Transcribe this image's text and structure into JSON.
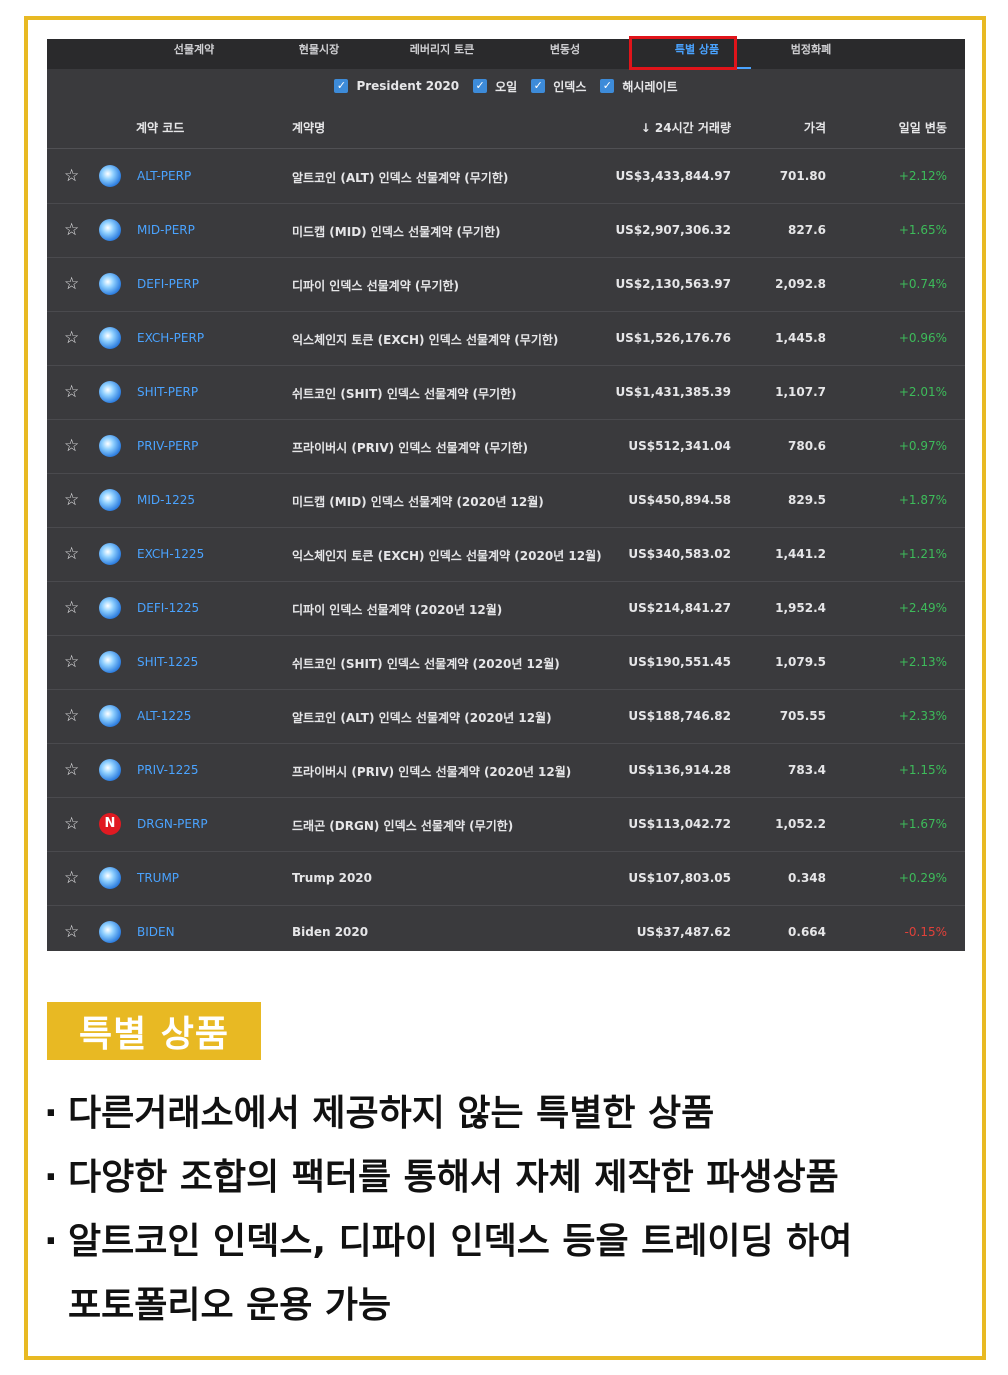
{
  "tabs": [
    {
      "label": "선물계약",
      "active": false
    },
    {
      "label": "현물시장",
      "active": false
    },
    {
      "label": "레버리지 토큰",
      "active": false
    },
    {
      "label": "변동성",
      "active": false
    },
    {
      "label": "특별 상품",
      "active": true
    },
    {
      "label": "범정화폐",
      "active": false
    }
  ],
  "filters": [
    {
      "label": "President 2020",
      "checked": true
    },
    {
      "label": "오일",
      "checked": true
    },
    {
      "label": "인덱스",
      "checked": true
    },
    {
      "label": "해시레이트",
      "checked": true
    }
  ],
  "columns": {
    "code": "계약 코드",
    "name": "계약명",
    "volume": "↓ 24시간 거래량",
    "price": "가격",
    "change": "일일 변동"
  },
  "rows": [
    {
      "code": "ALT-PERP",
      "name": "알트코인 (ALT) 인덱스 선물계약 (무기한)",
      "volume": "US$3,433,844.97",
      "price": "701.80",
      "change": "+2.12%",
      "icon": "globe-icon"
    },
    {
      "code": "MID-PERP",
      "name": "미드캡 (MID) 인덱스 선물계약 (무기한)",
      "volume": "US$2,907,306.32",
      "price": "827.6",
      "change": "+1.65%",
      "icon": "globe-icon"
    },
    {
      "code": "DEFI-PERP",
      "name": "디파이 인덱스 선물계약 (무기한)",
      "volume": "US$2,130,563.97",
      "price": "2,092.8",
      "change": "+0.74%",
      "icon": "globe-icon"
    },
    {
      "code": "EXCH-PERP",
      "name": "익스체인지 토큰 (EXCH) 인덱스 선물계약 (무기한)",
      "volume": "US$1,526,176.76",
      "price": "1,445.8",
      "change": "+0.96%",
      "icon": "globe-icon"
    },
    {
      "code": "SHIT-PERP",
      "name": "쉬트코인 (SHIT) 인덱스 선물계약 (무기한)",
      "volume": "US$1,431,385.39",
      "price": "1,107.7",
      "change": "+2.01%",
      "icon": "globe-icon"
    },
    {
      "code": "PRIV-PERP",
      "name": "프라이버시 (PRIV) 인덱스 선물계약 (무기한)",
      "volume": "US$512,341.04",
      "price": "780.6",
      "change": "+0.97%",
      "icon": "globe-icon"
    },
    {
      "code": "MID-1225",
      "name": "미드캡 (MID) 인덱스 선물계약 (2020년 12월)",
      "volume": "US$450,894.58",
      "price": "829.5",
      "change": "+1.87%",
      "icon": "globe-icon"
    },
    {
      "code": "EXCH-1225",
      "name": "익스체인지 토큰 (EXCH) 인덱스 선물계약 (2020년 12월)",
      "volume": "US$340,583.02",
      "price": "1,441.2",
      "change": "+1.21%",
      "icon": "globe-icon"
    },
    {
      "code": "DEFI-1225",
      "name": "디파이 인덱스 선물계약 (2020년 12월)",
      "volume": "US$214,841.27",
      "price": "1,952.4",
      "change": "+2.49%",
      "icon": "globe-icon"
    },
    {
      "code": "SHIT-1225",
      "name": "쉬트코인 (SHIT) 인덱스 선물계약 (2020년 12월)",
      "volume": "US$190,551.45",
      "price": "1,079.5",
      "change": "+2.13%",
      "icon": "globe-icon"
    },
    {
      "code": "ALT-1225",
      "name": "알트코인 (ALT) 인덱스 선물계약 (2020년 12월)",
      "volume": "US$188,746.82",
      "price": "705.55",
      "change": "+2.33%",
      "icon": "globe-icon"
    },
    {
      "code": "PRIV-1225",
      "name": "프라이버시 (PRIV) 인덱스 선물계약 (2020년 12월)",
      "volume": "US$136,914.28",
      "price": "783.4",
      "change": "+1.15%",
      "icon": "globe-icon"
    },
    {
      "code": "DRGN-PERP",
      "name": "드래곤 (DRGN) 인덱스 선물계약 (무기한)",
      "volume": "US$113,042.72",
      "price": "1,052.2",
      "change": "+1.67%",
      "icon": "dragonchain-icon",
      "icon_letter": "N"
    },
    {
      "code": "TRUMP",
      "name": "Trump 2020",
      "volume": "US$107,803.05",
      "price": "0.348",
      "change": "+0.29%",
      "icon": "globe-icon"
    },
    {
      "code": "BIDEN",
      "name": "Biden 2020",
      "volume": "US$37,487.62",
      "price": "0.664",
      "change": "-0.15%",
      "icon": "globe-icon"
    }
  ],
  "colors": {
    "frame": "#e8b923",
    "accent": "#4aa3ff",
    "positive": "#3dbb5a",
    "negative": "#e0413a",
    "highlight_box": "#e0141a"
  },
  "badge": {
    "label": "특별 상품"
  },
  "bullets": [
    "다른거래소에서 제공하지 않는 특별한 상품",
    "다양한 조합의 팩터를 통해서 자체 제작한 파생상품",
    "알트코인 인덱스, 디파이 인덱스 등을 트레이딩 하여",
    "포토폴리오 운용 가능"
  ],
  "bullet_marker": "·"
}
